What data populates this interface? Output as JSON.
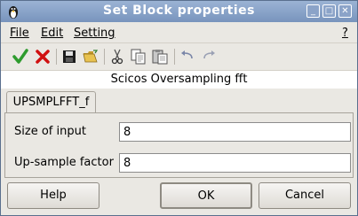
{
  "window": {
    "title": "Set Block properties"
  },
  "menu": {
    "file": "File",
    "edit": "Edit",
    "setting": "Setting",
    "help": "?"
  },
  "toolbar": {
    "icons": [
      "ok-check-icon",
      "cancel-x-icon",
      "save-icon",
      "open-folder-icon",
      "cut-icon",
      "copy-icon",
      "paste-icon",
      "undo-icon",
      "redo-icon"
    ]
  },
  "block": {
    "description": "Scicos Oversampling fft"
  },
  "tab": {
    "label": "UPSMPLFFT_f"
  },
  "fields": [
    {
      "label": "Size of input",
      "value": "8"
    },
    {
      "label": "Up-sample factor",
      "value": "8"
    }
  ],
  "buttons": {
    "help": "Help",
    "ok": "OK",
    "cancel": "Cancel"
  },
  "colors": {
    "titlebar": "#7894bd",
    "ok_icon": "#2e9b2e",
    "cancel_icon": "#d01010"
  }
}
